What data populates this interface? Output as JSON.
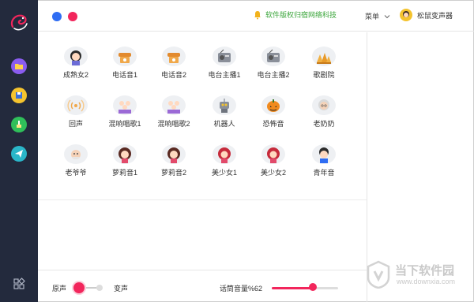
{
  "header": {
    "notice_text": "软件版权归宿网络科技",
    "menu_label": "菜单",
    "user_name": "松鼠变声器"
  },
  "voices": [
    {
      "label": "成熟女2",
      "icon": "mature-woman-icon"
    },
    {
      "label": "电话音1",
      "icon": "telephone-icon"
    },
    {
      "label": "电话音2",
      "icon": "telephone-icon"
    },
    {
      "label": "电台主播1",
      "icon": "radio-icon"
    },
    {
      "label": "电台主播2",
      "icon": "radio-icon"
    },
    {
      "label": "歌剧院",
      "icon": "opera-house-icon"
    },
    {
      "label": "回声",
      "icon": "echo-icon"
    },
    {
      "label": "混响唱歌1",
      "icon": "choir-icon"
    },
    {
      "label": "混响唱歌2",
      "icon": "choir-icon"
    },
    {
      "label": "机器人",
      "icon": "robot-icon"
    },
    {
      "label": "恐怖音",
      "icon": "pumpkin-icon"
    },
    {
      "label": "老奶奶",
      "icon": "grandma-icon"
    },
    {
      "label": "老爷爷",
      "icon": "grandpa-icon"
    },
    {
      "label": "萝莉音1",
      "icon": "loli-girl-icon"
    },
    {
      "label": "萝莉音2",
      "icon": "loli-girl-icon"
    },
    {
      "label": "美少女1",
      "icon": "beauty-girl-icon"
    },
    {
      "label": "美少女2",
      "icon": "beauty-girl-icon"
    },
    {
      "label": "青年音",
      "icon": "young-man-icon"
    }
  ],
  "bottom": {
    "original_label": "原声",
    "changed_label": "变声",
    "volume_label": "话筒音量%62",
    "volume_level": 62
  },
  "watermark": {
    "title": "当下软件园",
    "url": "www.downxia.com"
  },
  "colors": {
    "sidebar_bg": "#232a3d",
    "accent": "#f2265c",
    "blue_dot": "#2f6df3",
    "notice_green": "#3aa53a"
  }
}
